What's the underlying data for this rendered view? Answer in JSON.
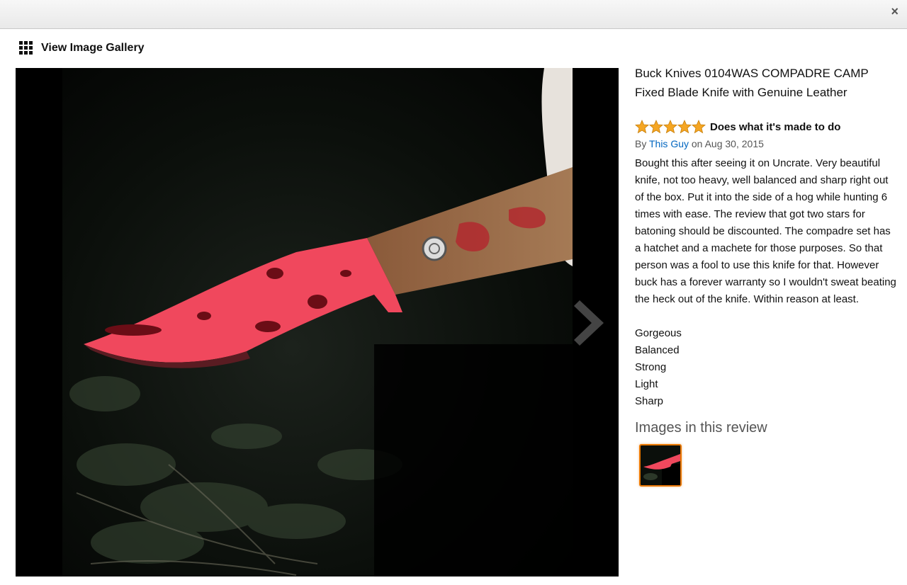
{
  "window": {
    "close_icon": "×"
  },
  "gallery": {
    "label": "View Image Gallery",
    "icon": "grid-icon"
  },
  "product": {
    "title": "Buck Knives 0104WAS COMPADRE CAMP Fixed Blade Knife with Genuine Leather"
  },
  "review": {
    "rating": 5,
    "rating_max": 5,
    "title": "Does what it's made to do",
    "by_prefix": "By",
    "author": "This Guy",
    "date_prefix": "on",
    "date": "Aug 30, 2015",
    "body": "Bought this after seeing it on Uncrate. Very beautiful knife, not too heavy, well balanced and sharp right out of the box. Put it into the side of a hog while hunting 6 times with ease. The review that got two stars for batoning should be discounted. The compadre set has a hatchet and a machete for those purposes. So that person was a fool to use this knife for that. However buck has a forever warranty so I wouldn't sweat beating the heck out of the knife. Within reason at least.",
    "traits": [
      "Gorgeous",
      "Balanced",
      "Strong",
      "Light",
      "Sharp"
    ]
  },
  "images_section": {
    "heading": "Images in this review"
  },
  "colors": {
    "star": "#f5a623",
    "link": "#0066c0",
    "thumb_border": "#e77600"
  }
}
